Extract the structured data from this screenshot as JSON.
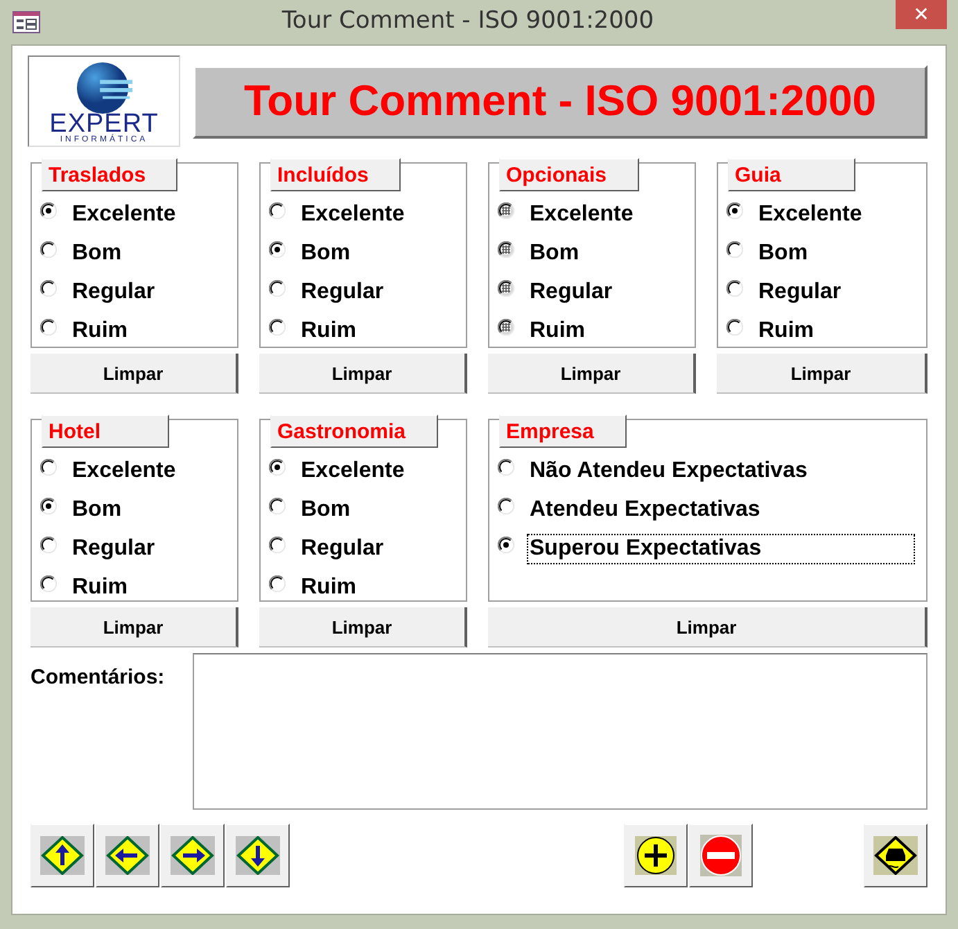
{
  "window": {
    "title": "Tour Comment - ISO 9001:2000",
    "close": "✕"
  },
  "logo": {
    "text": "EXPERT",
    "subtext": "INFORMÁTICA"
  },
  "banner": "Tour Comment - ISO 9001:2000",
  "group_rows": [
    {
      "groups": [
        {
          "title": "Traslados",
          "indeterminate": false,
          "clear_button": "Limpar",
          "options": [
            {
              "label": "Excelente",
              "selected": true
            },
            {
              "label": "Bom",
              "selected": false
            },
            {
              "label": "Regular",
              "selected": false
            },
            {
              "label": "Ruim",
              "selected": false
            }
          ]
        },
        {
          "title": "Incluídos",
          "indeterminate": false,
          "clear_button": "Limpar",
          "options": [
            {
              "label": "Excelente",
              "selected": false
            },
            {
              "label": "Bom",
              "selected": true
            },
            {
              "label": "Regular",
              "selected": false
            },
            {
              "label": "Ruim",
              "selected": false
            }
          ]
        },
        {
          "title": "Opcionais",
          "indeterminate": true,
          "clear_button": "Limpar",
          "options": [
            {
              "label": "Excelente",
              "selected": false
            },
            {
              "label": "Bom",
              "selected": false
            },
            {
              "label": "Regular",
              "selected": false
            },
            {
              "label": "Ruim",
              "selected": false
            }
          ]
        },
        {
          "title": "Guia",
          "indeterminate": false,
          "clear_button": "Limpar",
          "options": [
            {
              "label": "Excelente",
              "selected": true
            },
            {
              "label": "Bom",
              "selected": false
            },
            {
              "label": "Regular",
              "selected": false
            },
            {
              "label": "Ruim",
              "selected": false
            }
          ]
        }
      ]
    },
    {
      "groups": [
        {
          "title": "Hotel",
          "indeterminate": false,
          "clear_button": "Limpar",
          "options": [
            {
              "label": "Excelente",
              "selected": false
            },
            {
              "label": "Bom",
              "selected": true
            },
            {
              "label": "Regular",
              "selected": false
            },
            {
              "label": "Ruim",
              "selected": false
            }
          ]
        },
        {
          "title": "Gastronomia",
          "indeterminate": false,
          "clear_button": "Limpar",
          "options": [
            {
              "label": "Excelente",
              "selected": true
            },
            {
              "label": "Bom",
              "selected": false
            },
            {
              "label": "Regular",
              "selected": false
            },
            {
              "label": "Ruim",
              "selected": false
            }
          ]
        },
        {
          "title": "Empresa",
          "indeterminate": false,
          "clear_button": "Limpar",
          "options": [
            {
              "label": "Não Atendeu Expectativas",
              "selected": false,
              "focused": false
            },
            {
              "label": "Atendeu Expectativas",
              "selected": false,
              "focused": false
            },
            {
              "label": "Superou Expectativas",
              "selected": true,
              "focused": true
            }
          ]
        }
      ]
    }
  ],
  "comments": {
    "label": "Comentários:"
  },
  "toolbar": {
    "groups": [
      {
        "buttons": [
          {
            "kind": "up"
          },
          {
            "kind": "left"
          },
          {
            "kind": "right"
          },
          {
            "kind": "down"
          }
        ]
      },
      {
        "buttons": [
          {
            "kind": "add"
          },
          {
            "kind": "delete"
          }
        ]
      },
      {
        "buttons": [
          {
            "kind": "road"
          }
        ]
      }
    ]
  }
}
